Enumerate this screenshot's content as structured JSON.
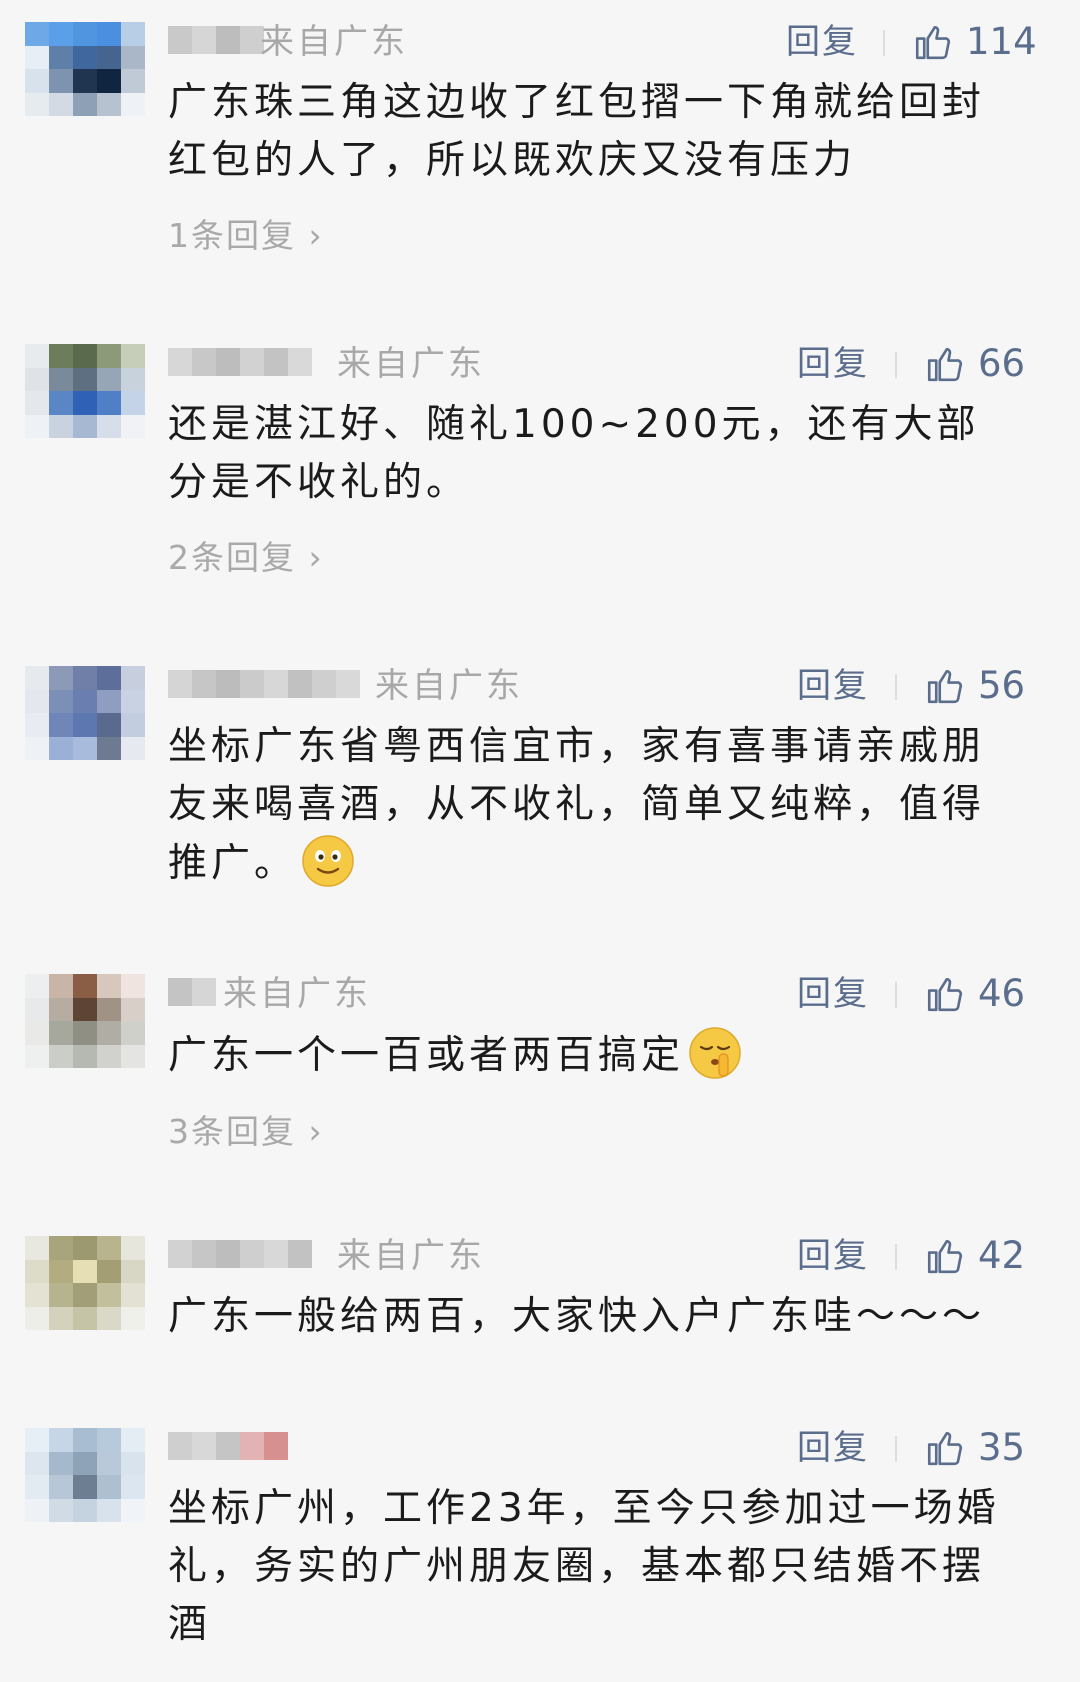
{
  "comments": [
    {
      "region": "来自广东",
      "reply_label": "回复",
      "likes": "114",
      "text": "广东珠三角这边收了红包摺一下角就给回封红包的人了，所以既欢庆又没有压力",
      "replies": "1条回复",
      "avatar_colors": [
        "#6fa8e6",
        "#5a9fe8",
        "#4f95e0",
        "#4a8fe0",
        "#b8cde6",
        "#e8eef5",
        "#5e7fa8",
        "#41689e",
        "#45648f",
        "#a9b7c8",
        "#d8e2ec",
        "#7e93b0",
        "#1f3550",
        "#0f2540",
        "#c0cad6",
        "#e6ebf0",
        "#d3dae3",
        "#8ea0b6",
        "#b6c2d0",
        "#eef1f5"
      ],
      "name_colors": [
        "#c9c9c9",
        "#d6d6d6",
        "#bdbdbd",
        "#cfcfcf"
      ]
    },
    {
      "region": "来自广东",
      "reply_label": "回复",
      "likes": "66",
      "text": "还是湛江好、随礼100~200元，还有大部分是不收礼的。",
      "replies": "2条回复",
      "avatar_colors": [
        "#e8ebee",
        "#6d7d5c",
        "#5a6a4c",
        "#8d9a7a",
        "#c6cdb8",
        "#dfe3e7",
        "#7b8a9a",
        "#5f6f82",
        "#97a6b6",
        "#c8d2dc",
        "#e4e8ec",
        "#5a86c6",
        "#2f62b6",
        "#4f7fc7",
        "#c4d3e8",
        "#eef1f5",
        "#c9d3e0",
        "#a7b9d2",
        "#d5dee9",
        "#f0f2f5"
      ],
      "name_colors": [
        "#d7d7d7",
        "#c8c8c8",
        "#bdbdbd",
        "#d2d2d2",
        "#c3c3c3",
        "#d9d9d9"
      ]
    },
    {
      "region": "来自广东",
      "reply_label": "回复",
      "likes": "56",
      "text": "坐标广东省粤西信宜市，家有喜事请亲戚朋友来喝喜酒，从不收礼，简单又纯粹，值得推广。",
      "replies": "",
      "avatar_colors": [
        "#e6e9ee",
        "#8c9ab8",
        "#6f7fa8",
        "#5d6e9a",
        "#c7cfdf",
        "#e4e8ee",
        "#7c8fb6",
        "#6a7fb0",
        "#8f9ec0",
        "#c9d2e2",
        "#e8ecf2",
        "#7086b8",
        "#5d77b0",
        "#5a6a8e",
        "#c3cde0",
        "#eef1f5",
        "#9ab0d6",
        "#a8bbdc",
        "#6e7a92",
        "#e6eaf0"
      ],
      "name_colors": [
        "#d5d5d5",
        "#c6c6c6",
        "#bcbcbc",
        "#cbcbcb",
        "#d7d7d7",
        "#c1c1c1",
        "#cfcfcf",
        "#d9d9d9"
      ]
    },
    {
      "region": "来自广东",
      "reply_label": "回复",
      "likes": "46",
      "text": "广东一个一百或者两百搞定",
      "replies": "3条回复",
      "avatar_colors": [
        "#eceeef",
        "#c9b5a8",
        "#8a5e45",
        "#d7c7bc",
        "#f0e4e0",
        "#e8e9ea",
        "#b7aca2",
        "#5d4434",
        "#a09284",
        "#d8cfc8",
        "#e9eae8",
        "#a6a89e",
        "#8f8f84",
        "#b0aea4",
        "#d0d0ca",
        "#eef0ef",
        "#cbcdc8",
        "#b6b8b2",
        "#d1d2ce",
        "#e4e5e2"
      ],
      "name_colors": [
        "#c4c4c4",
        "#d6d6d6"
      ]
    },
    {
      "region": "来自广东",
      "reply_label": "回复",
      "likes": "42",
      "text": "广东一般给两百，大家快入户广东哇～～～",
      "replies": "",
      "avatar_colors": [
        "#e8e8e0",
        "#a8a47c",
        "#9c9870",
        "#b8b48e",
        "#e6e6dc",
        "#dcdcc8",
        "#b2ac80",
        "#e6dfb6",
        "#a49e74",
        "#d8d6c4",
        "#e4e2d2",
        "#b6b48e",
        "#a29e78",
        "#c2c09c",
        "#e2e1d4",
        "#eeeee8",
        "#d4d2bc",
        "#c6c4a6",
        "#dad8c6",
        "#f0f0ea"
      ],
      "name_colors": [
        "#d2d2d2",
        "#c6c6c6",
        "#bdbdbd",
        "#cfcfcf",
        "#d8d8d8",
        "#c2c2c2"
      ]
    },
    {
      "region": "",
      "reply_label": "回复",
      "likes": "35",
      "text": "坐标广州，工作23年，至今只参加过一场婚礼，务实的广州朋友圈，基本都只结婚不摆酒",
      "replies": "",
      "avatar_colors": [
        "#e6eef6",
        "#c6d6e6",
        "#a8bcd2",
        "#b6cadc",
        "#e4ecf4",
        "#dde6ef",
        "#a6b8cc",
        "#8fa3b8",
        "#b9c9da",
        "#d9e3ee",
        "#e2eaf2",
        "#b7c7d8",
        "#6e7e92",
        "#aebfd0",
        "#dce6f0",
        "#eef2f6",
        "#d0dbe6",
        "#c5d2df",
        "#d8e2ec",
        "#f0f4f8"
      ],
      "name_colors": [
        "#cfcfcf",
        "#d8d8d8",
        "#c5c5c5",
        "#e3b3b3",
        "#d69090"
      ]
    }
  ],
  "icons": {
    "like": "thumbs-up-icon",
    "chevron": "chevron-right-icon",
    "emoji_smile": "smiling-emoji-icon",
    "emoji_shush": "shushing-emoji-icon"
  },
  "colors": {
    "link": "#5b6d8c",
    "muted": "#a8a8a8",
    "background": "#f6f6f6"
  }
}
